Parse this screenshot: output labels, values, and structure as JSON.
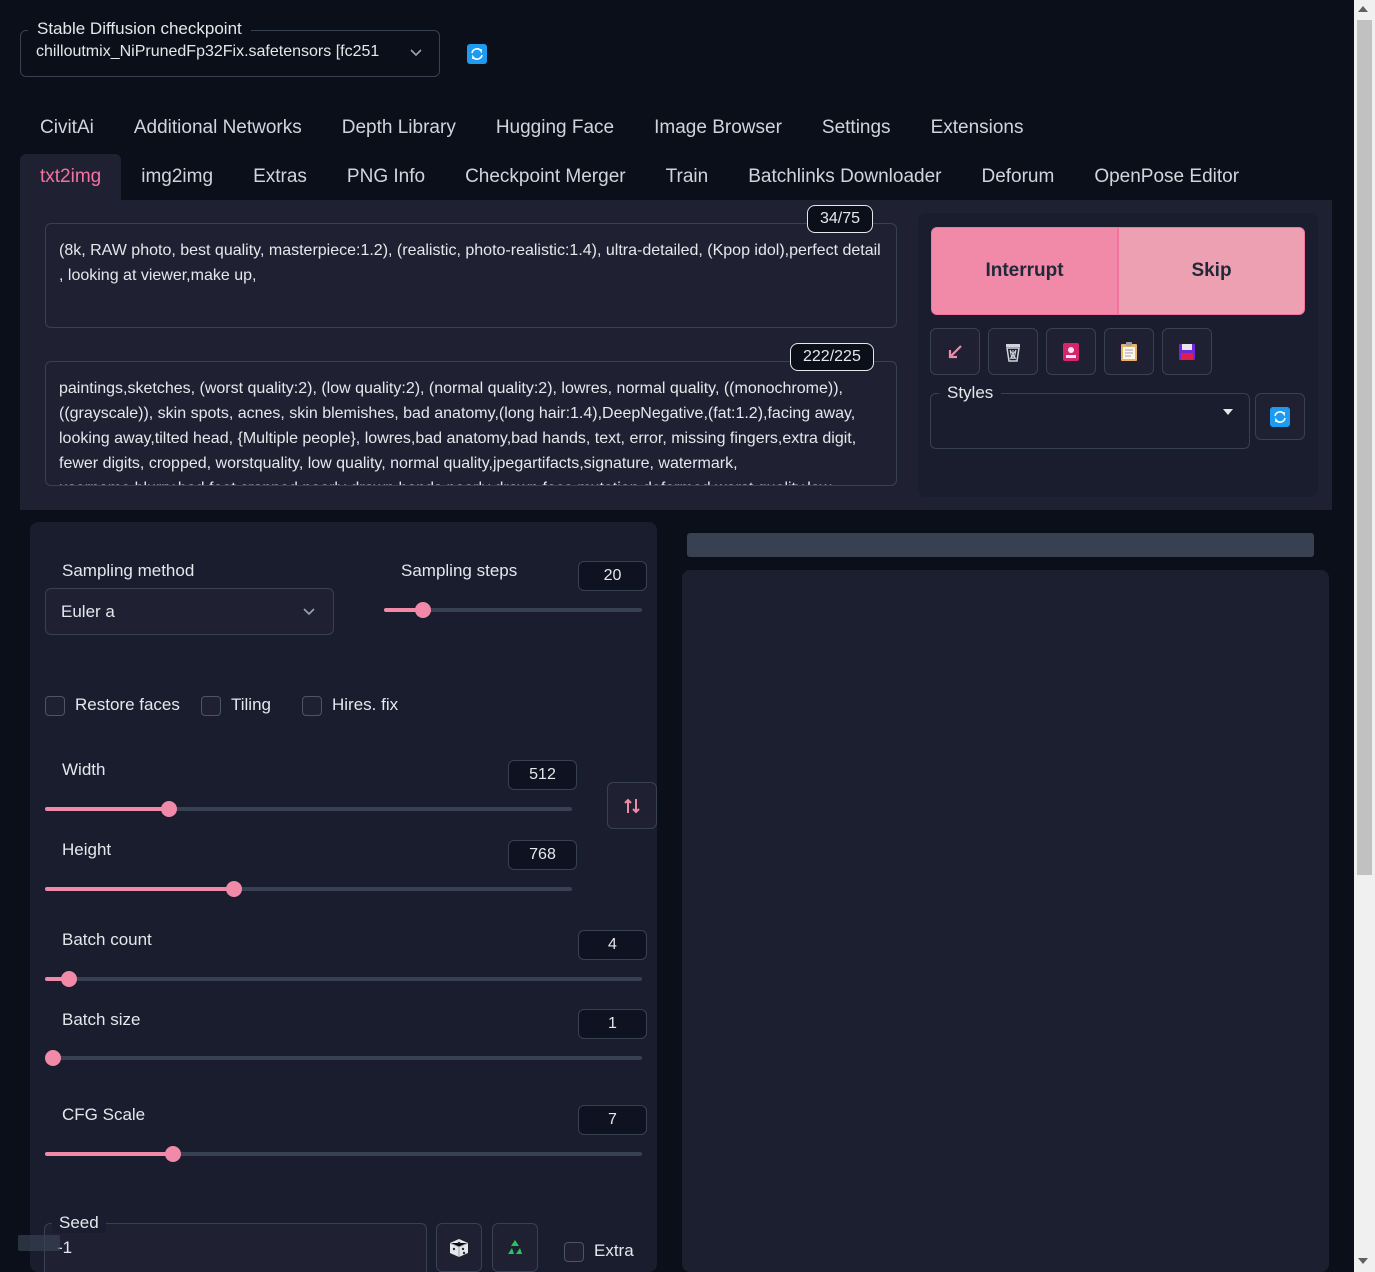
{
  "checkpoint": {
    "label": "Stable Diffusion checkpoint",
    "value": "chilloutmix_NiPrunedFp32Fix.safetensors [fc251"
  },
  "tabs_top": [
    "CivitAi",
    "Additional Networks",
    "Depth Library",
    "Hugging Face",
    "Image Browser",
    "Settings",
    "Extensions"
  ],
  "tabs_main": [
    "txt2img",
    "img2img",
    "Extras",
    "PNG Info",
    "Checkpoint Merger",
    "Train",
    "Batchlinks Downloader",
    "Deforum",
    "OpenPose Editor"
  ],
  "active_tab": "txt2img",
  "prompt": {
    "text": "(8k, RAW photo, best quality, masterpiece:1.2), (realistic, photo-realistic:1.4), ultra-detailed, (Kpop idol),perfect detail ,  looking at viewer,make up,",
    "counter": "34/75"
  },
  "negative_prompt": {
    "text": "paintings,sketches, (worst quality:2), (low quality:2), (normal quality:2), lowres, normal quality, ((monochrome)), ((grayscale)), skin spots, acnes, skin blemishes, bad anatomy,(long hair:1.4),DeepNegative,(fat:1.2),facing away, looking away,tilted head, {Multiple people}, lowres,bad anatomy,bad hands, text, error, missing fingers,extra digit, fewer digits, cropped, worstquality, low quality, normal quality,jpegartifacts,signature, watermark, username,blurry,bad feet,cropped,poorly drawn hands,poorly drawn face,mutation,deformed,worst quality,low",
    "counter": "222/225"
  },
  "buttons": {
    "interrupt": "Interrupt",
    "skip": "Skip"
  },
  "tools": [
    "arrow-icon",
    "trash-icon",
    "card-icon",
    "clipboard-icon",
    "save-icon"
  ],
  "styles": {
    "label": "Styles",
    "value": ""
  },
  "sampling": {
    "method_label": "Sampling method",
    "method_value": "Euler a",
    "steps_label": "Sampling steps",
    "steps_value": "20",
    "steps_frac": 0.15
  },
  "checkboxes": {
    "restore_faces": "Restore faces",
    "tiling": "Tiling",
    "hires": "Hires. fix"
  },
  "width": {
    "label": "Width",
    "value": "512",
    "frac": 0.235
  },
  "height": {
    "label": "Height",
    "value": "768",
    "frac": 0.358
  },
  "batch_count": {
    "label": "Batch count",
    "value": "4",
    "frac": 0.04
  },
  "batch_size": {
    "label": "Batch size",
    "value": "1",
    "frac": 0.0
  },
  "cfg": {
    "label": "CFG Scale",
    "value": "7",
    "frac": 0.215
  },
  "seed": {
    "label": "Seed",
    "value": "-1",
    "extra_label": "Extra"
  },
  "colors": {
    "accent": "#f08aa8",
    "background": "#0b0f19",
    "panel": "#1a1d2e"
  }
}
